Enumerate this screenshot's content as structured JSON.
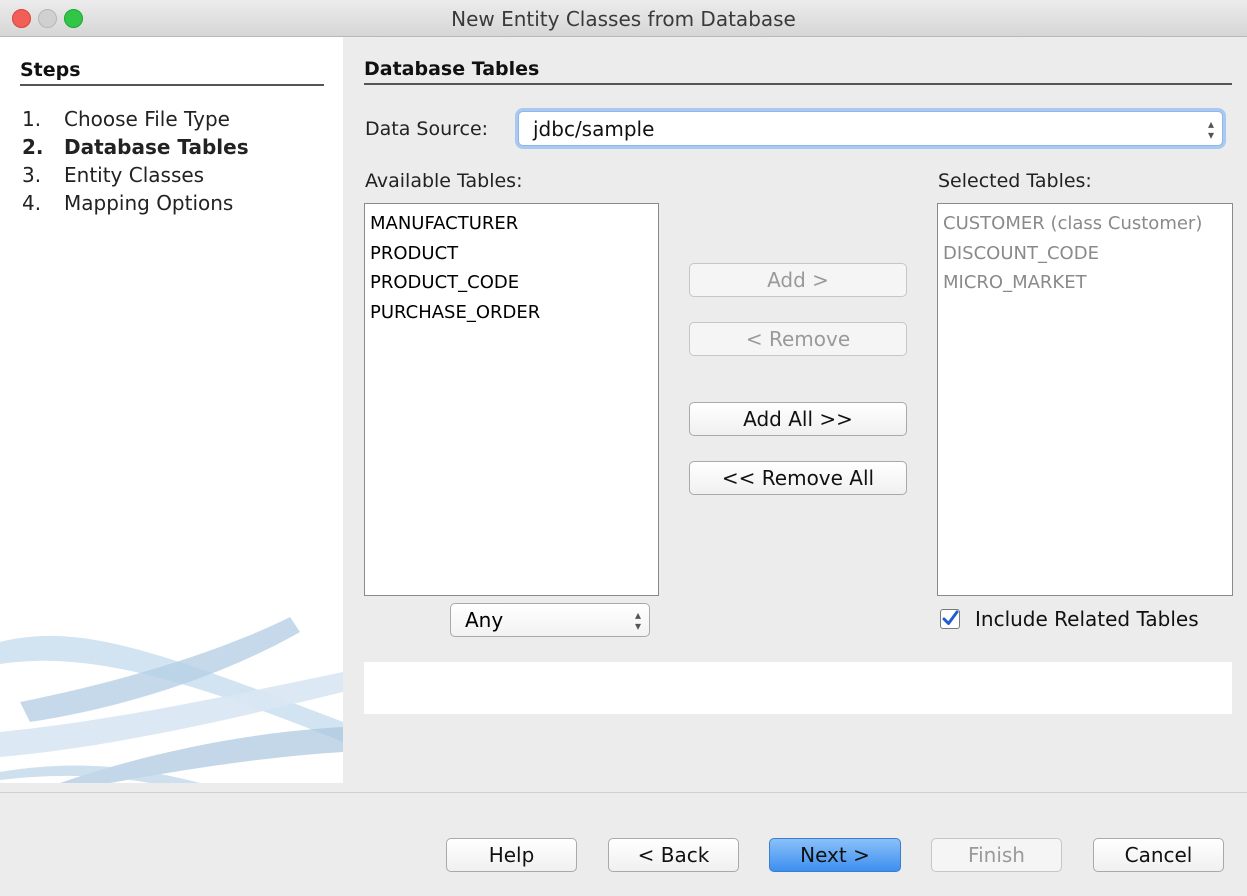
{
  "window": {
    "title": "New Entity Classes from Database"
  },
  "steps": {
    "heading": "Steps",
    "items": [
      {
        "num": "1.",
        "label": "Choose File Type"
      },
      {
        "num": "2.",
        "label": "Database Tables"
      },
      {
        "num": "3.",
        "label": "Entity Classes"
      },
      {
        "num": "4.",
        "label": "Mapping Options"
      }
    ],
    "current_index": 1
  },
  "main": {
    "heading": "Database Tables",
    "data_source_label": "Data Source:",
    "data_source_value": "jdbc/sample",
    "available_label": "Available Tables:",
    "available_tables": [
      "MANUFACTURER",
      "PRODUCT",
      "PRODUCT_CODE",
      "PURCHASE_ORDER"
    ],
    "selected_label": "Selected Tables:",
    "selected_tables": [
      "CUSTOMER (class Customer)",
      "DISCOUNT_CODE",
      "MICRO_MARKET"
    ],
    "add_label": "Add >",
    "remove_label": "< Remove",
    "add_all_label": "Add All >>",
    "remove_all_label": "<< Remove All",
    "filter_value": "Any",
    "include_related_label": "Include Related Tables",
    "include_related_checked": true
  },
  "footer": {
    "help_label": "Help",
    "back_label": "< Back",
    "next_label": "Next >",
    "finish_label": "Finish",
    "cancel_label": "Cancel"
  }
}
